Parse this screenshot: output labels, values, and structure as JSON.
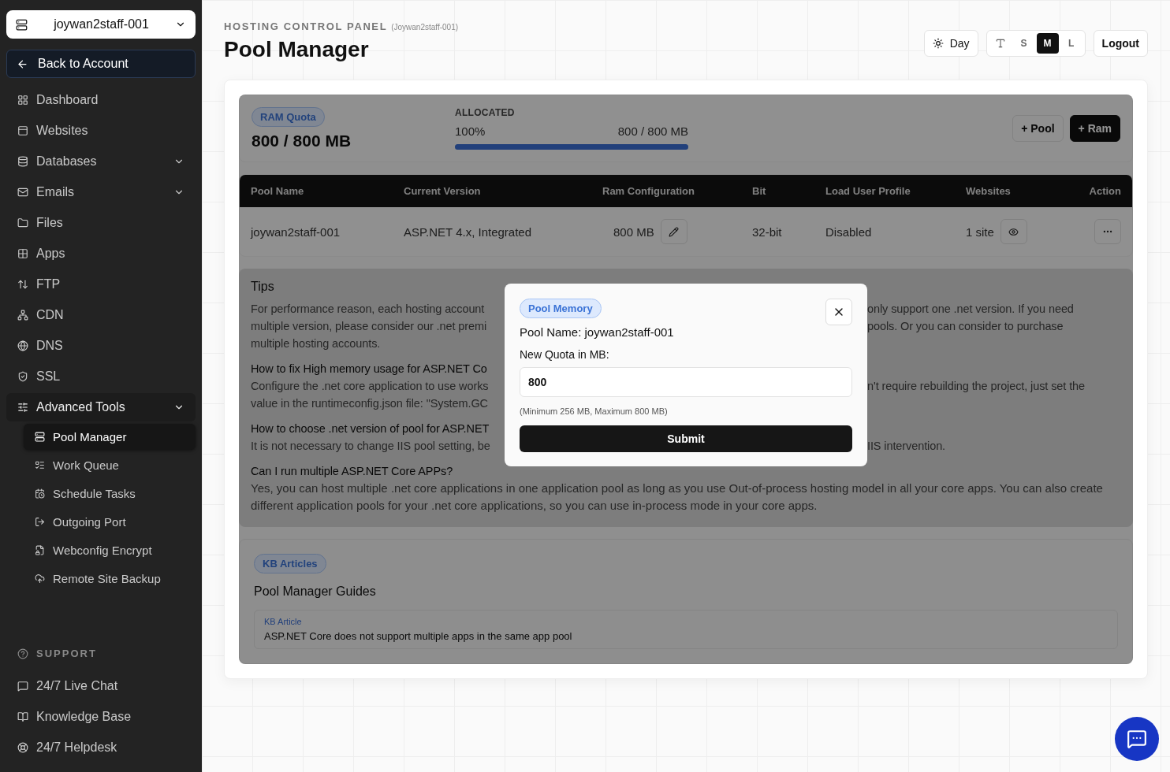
{
  "account_switcher": {
    "label": "joywan2staff-001"
  },
  "back_button": {
    "label": "Back to Account"
  },
  "nav": [
    {
      "label": "Dashboard",
      "selected": false
    },
    {
      "label": "Websites",
      "selected": false
    },
    {
      "label": "Databases",
      "selected": false,
      "expanded": false
    },
    {
      "label": "Emails",
      "selected": false,
      "expanded": false
    },
    {
      "label": "Files",
      "selected": false
    },
    {
      "label": "Apps",
      "selected": false
    },
    {
      "label": "FTP",
      "selected": false
    },
    {
      "label": "CDN",
      "selected": false
    },
    {
      "label": "DNS",
      "selected": false
    },
    {
      "label": "SSL",
      "selected": false
    },
    {
      "label": "Advanced Tools",
      "selected": false,
      "expanded": true,
      "children": [
        {
          "label": "Pool Manager",
          "selected": true
        },
        {
          "label": "Work Queue",
          "selected": false
        },
        {
          "label": "Schedule Tasks",
          "selected": false
        },
        {
          "label": "Outgoing Port",
          "selected": false
        },
        {
          "label": "Webconfig Encrypt",
          "selected": false
        },
        {
          "label": "Remote Site Backup",
          "selected": false
        }
      ]
    }
  ],
  "support": {
    "title": "SUPPORT",
    "items": [
      {
        "label": "24/7 Live Chat"
      },
      {
        "label": "Knowledge Base"
      },
      {
        "label": "24/7 Helpdesk"
      }
    ]
  },
  "header": {
    "eyebrow": "HOSTING CONTROL PANEL",
    "account": "(Joywan2staff-001)",
    "title": "Pool Manager"
  },
  "toolbar": {
    "theme": "Day",
    "font_sizes": [
      {
        "label": "S",
        "selected": false
      },
      {
        "label": "M",
        "selected": true
      },
      {
        "label": "L",
        "selected": false
      }
    ],
    "logout": "Logout"
  },
  "quota": {
    "badge": "RAM Quota",
    "value": "800 / 800 MB",
    "allocated_label": "ALLOCATED",
    "percent": "100%",
    "used": "800 / 800 MB",
    "level": 1,
    "buttons": [
      {
        "label": "+ Pool",
        "kind": "outline"
      },
      {
        "label": "+ Ram",
        "kind": "solid"
      }
    ]
  },
  "table": {
    "columns": [
      "Pool Name",
      "Current Version",
      "Ram Configuration",
      "Bit",
      "Load User Profile",
      "Websites",
      "Action"
    ],
    "rows": [
      {
        "pool_name": "joywan2staff-001",
        "version": "ASP.NET 4.x, Integrated",
        "ram": "800 MB",
        "bit": "32-bit",
        "load_user_profile": "Disabled",
        "websites": "1 site"
      }
    ]
  },
  "tips": {
    "title": "Tips",
    "lines": [
      {
        "kind": "text",
        "left": "For performance reason, each hosting account",
        "right": "only support one .net version. If you need"
      },
      {
        "kind": "text",
        "left": "multiple version, please consider our .net premi",
        "right": "pools. Or you can consider to purchase"
      },
      {
        "kind": "text",
        "left": "multiple hosting accounts."
      },
      {
        "kind": "heading",
        "left": "How to fix High memory usage for ASP.NET Co"
      },
      {
        "kind": "text",
        "left": "Configure the .net core application to use works",
        "right": "n't require rebuilding the project, just set the"
      },
      {
        "kind": "text",
        "left": "value in the runtimeconfig.json file: \"System.GC"
      },
      {
        "kind": "heading",
        "left": "How to choose .net version of pool for ASP.NET"
      },
      {
        "kind": "text",
        "left": "It is not necessary to change IIS pool setting, be",
        "right": "IIS intervention."
      },
      {
        "kind": "heading",
        "left": "Can I run multiple ASP.NET Core APPs?"
      },
      {
        "kind": "text",
        "left": "Yes, you can host multiple .net core applications in one application pool as long as you use Out-of-process hosting model in all your core apps. You can also create different application pools for your .net core applications, so you can use in-process mode in your core apps."
      }
    ]
  },
  "kb": {
    "badge": "KB Articles",
    "title": "Pool Manager Guides",
    "articles": [
      {
        "tag": "KB Article",
        "title": "ASP.NET Core does not support multiple apps in the same app pool"
      }
    ]
  },
  "modal": {
    "badge": "Pool Memory",
    "pool_name": "Pool Name: joywan2staff-001",
    "field_label": "New Quota in MB:",
    "value": "800",
    "hint": "(Minimum 256 MB, Maximum 800 MB)",
    "submit": "Submit"
  }
}
